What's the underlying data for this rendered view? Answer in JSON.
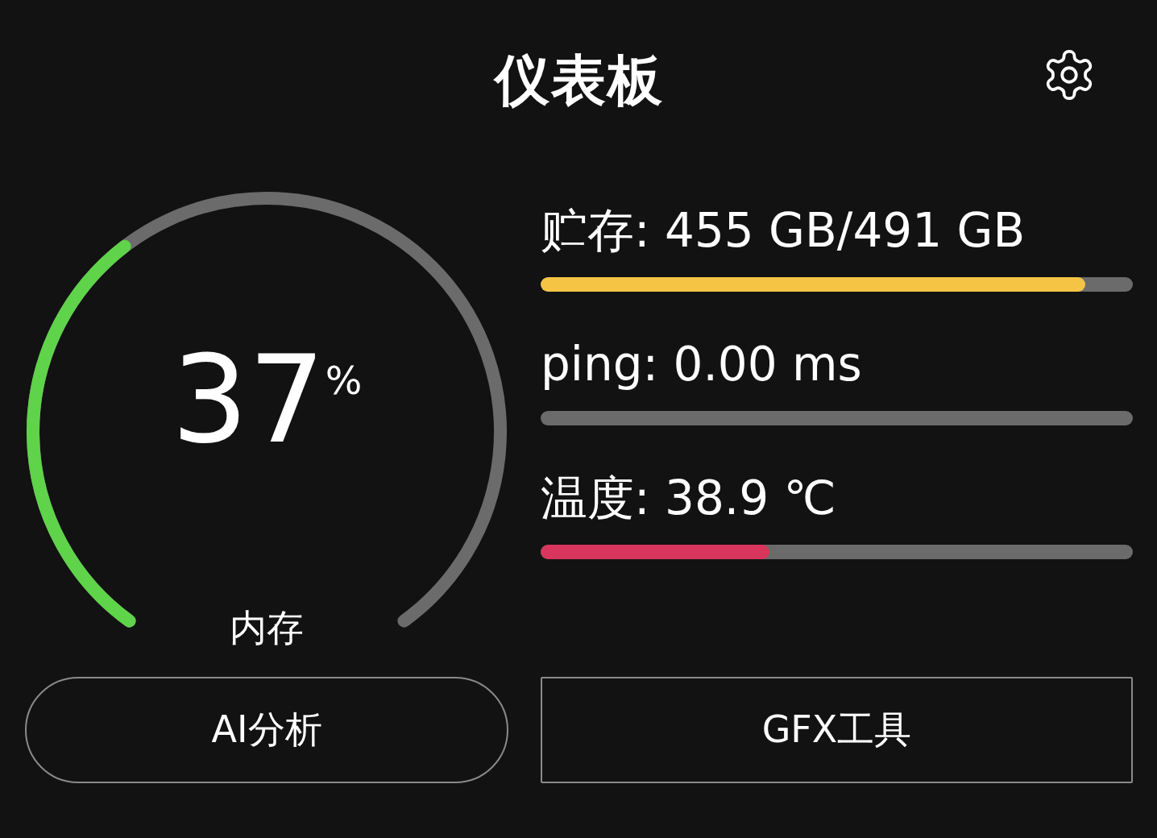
{
  "title": "仪表板",
  "gauge": {
    "value": "37",
    "unit": "%",
    "label": "内存"
  },
  "metrics": [
    {
      "label": "贮存: 455 GB/491 GB",
      "level": 0.92,
      "color": "#f5c445"
    },
    {
      "label": "ping: 0.00 ms"
    },
    {
      "label": "温度: 38.9 ℃",
      "level": 0.387,
      "color": "#d8365c"
    }
  ],
  "buttons": [
    {
      "label": "AI分析",
      "kind": "pill"
    },
    {
      "label": "GFX工具",
      "kind": "rect"
    }
  ]
}
